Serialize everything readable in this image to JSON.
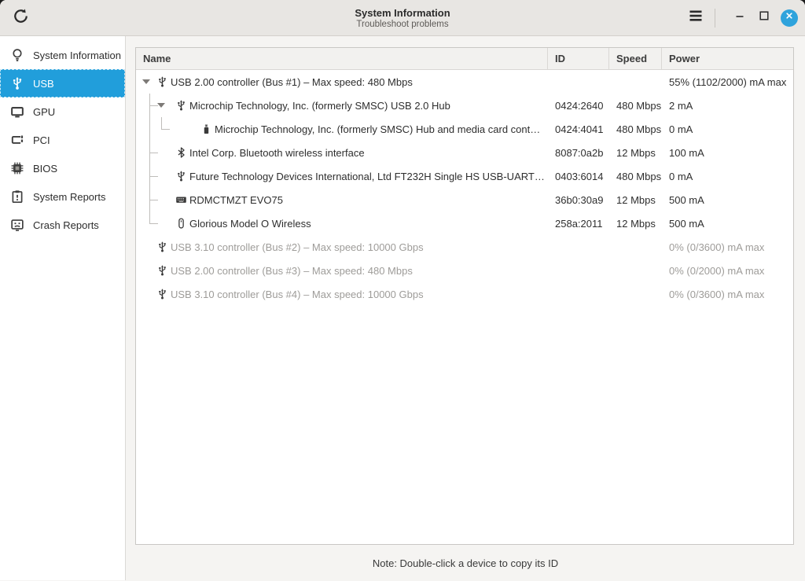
{
  "window": {
    "title": "System Information",
    "subtitle": "Troubleshoot problems"
  },
  "titlebar_icons": [
    "refresh-icon",
    "hamburger-menu-icon",
    "minimize-icon",
    "maximize-icon",
    "close-icon"
  ],
  "colors": {
    "accent_blue": "#219edb",
    "close_button_blue": "#2fa3dc",
    "titlebar_bg": "#e8e6e3",
    "grayed_text": "#9e9c99"
  },
  "sidebar": {
    "items": [
      {
        "label": "System Information",
        "icon": "lightbulb-icon",
        "selected": false
      },
      {
        "label": "USB",
        "icon": "usb-icon",
        "selected": true
      },
      {
        "label": "GPU",
        "icon": "monitor-icon",
        "selected": false
      },
      {
        "label": "PCI",
        "icon": "pci-card-icon",
        "selected": false
      },
      {
        "label": "BIOS",
        "icon": "chip-icon",
        "selected": false
      },
      {
        "label": "System Reports",
        "icon": "clipboard-report-icon",
        "selected": false
      },
      {
        "label": "Crash Reports",
        "icon": "crash-face-icon",
        "selected": false
      }
    ]
  },
  "table": {
    "columns": [
      "Name",
      "ID",
      "Speed",
      "Power"
    ],
    "rows": [
      {
        "name": "USB  2.00 controller (Bus #1) – Max speed: 480 Mbps",
        "id": "",
        "speed": "",
        "power": "55% (1102/2000) mA max",
        "icon": "usb-icon",
        "depth": 0,
        "expander": true,
        "last": false,
        "grayed": false
      },
      {
        "name": "Microchip Technology, Inc. (formerly SMSC) USB 2.0 Hub",
        "id": "0424:2640",
        "speed": "480 Mbps",
        "power": "2 mA",
        "icon": "usb-icon",
        "depth": 1,
        "expander": true,
        "last": false,
        "grayed": false
      },
      {
        "name": "Microchip Technology, Inc. (formerly SMSC) Hub and media card cont…",
        "id": "0424:4041",
        "speed": "480 Mbps",
        "power": "0 mA",
        "icon": "flash-drive-icon",
        "depth": 2,
        "expander": false,
        "last": true,
        "grayed": false
      },
      {
        "name": "Intel Corp. Bluetooth wireless interface",
        "id": "8087:0a2b",
        "speed": "12 Mbps",
        "power": "100 mA",
        "icon": "bluetooth-icon",
        "depth": 1,
        "expander": false,
        "last": false,
        "grayed": false
      },
      {
        "name": "Future Technology Devices International, Ltd FT232H Single HS USB-UART…",
        "id": "0403:6014",
        "speed": "480 Mbps",
        "power": "0 mA",
        "icon": "usb-icon",
        "depth": 1,
        "expander": false,
        "last": false,
        "grayed": false
      },
      {
        "name": "RDMCTMZT EVO75",
        "id": "36b0:30a9",
        "speed": "12 Mbps",
        "power": "500 mA",
        "icon": "keyboard-icon",
        "depth": 1,
        "expander": false,
        "last": false,
        "grayed": false
      },
      {
        "name": "Glorious Model O Wireless",
        "id": "258a:2011",
        "speed": "12 Mbps",
        "power": "500 mA",
        "icon": "mouse-icon",
        "depth": 1,
        "expander": false,
        "last": true,
        "grayed": false
      },
      {
        "name": "USB  3.10 controller (Bus #2) – Max speed: 10000 Gbps",
        "id": "",
        "speed": "",
        "power": "0% (0/3600) mA max",
        "icon": "usb-icon",
        "depth": 0,
        "expander": false,
        "last": false,
        "grayed": true
      },
      {
        "name": "USB  2.00 controller (Bus #3) – Max speed: 480 Mbps",
        "id": "",
        "speed": "",
        "power": "0% (0/2000) mA max",
        "icon": "usb-icon",
        "depth": 0,
        "expander": false,
        "last": false,
        "grayed": true
      },
      {
        "name": "USB  3.10 controller (Bus #4) – Max speed: 10000 Gbps",
        "id": "",
        "speed": "",
        "power": "0% (0/3600) mA max",
        "icon": "usb-icon",
        "depth": 0,
        "expander": false,
        "last": false,
        "grayed": true
      }
    ]
  },
  "note": "Note: Double-click a device to copy its ID"
}
